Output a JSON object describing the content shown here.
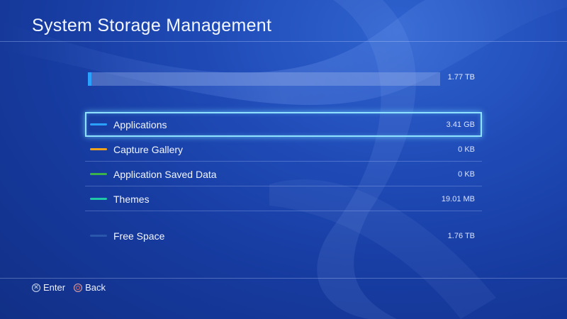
{
  "header": {
    "title": "System Storage Management"
  },
  "usage": {
    "total": "1.77 TB",
    "used_fraction": 0.01,
    "fill_color": "#2aa0ff"
  },
  "categories": [
    {
      "label": "Applications",
      "size": "3.41 GB",
      "color": "#2aa0ff",
      "selected": true
    },
    {
      "label": "Capture Gallery",
      "size": "0 KB",
      "color": "#f0a21a",
      "selected": false
    },
    {
      "label": "Application Saved Data",
      "size": "0 KB",
      "color": "#3bb24a",
      "selected": false
    },
    {
      "label": "Themes",
      "size": "19.01 MB",
      "color": "#1fc9a8",
      "selected": false
    }
  ],
  "free_space": {
    "label": "Free Space",
    "size": "1.76 TB",
    "color": "#2f5fb0"
  },
  "footer": {
    "enter": {
      "icon": "cross-button-icon",
      "label": "Enter"
    },
    "back": {
      "icon": "circle-button-icon",
      "label": "Back"
    }
  },
  "colors": {
    "background": "#1f4ab6",
    "selection_border": "#8fe2ff"
  }
}
